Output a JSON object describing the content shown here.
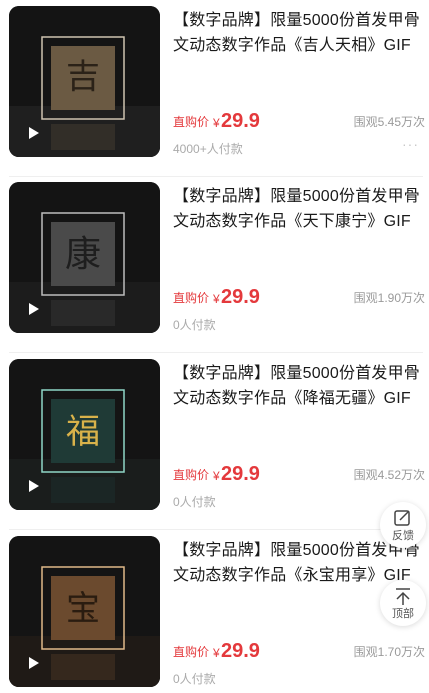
{
  "products": [
    {
      "title": "【数字品牌】限量5000份首发甲骨文动态数字作品《吉人天相》GIF",
      "price_label": "直购价",
      "currency": "¥",
      "price": "29.9",
      "views": "围观5.45万次",
      "paid": "4000+人付款",
      "more": "···",
      "glyph": "吉",
      "tone": "#6b5a43",
      "frame": "#cfc4b0"
    },
    {
      "title": "【数字品牌】限量5000份首发甲骨文动态数字作品《天下康宁》GIF",
      "price_label": "直购价",
      "currency": "¥",
      "price": "29.9",
      "views": "围观1.90万次",
      "paid": "0人付款",
      "more": "···",
      "glyph": "康",
      "tone": "#4a4a4a",
      "frame": "#bdbdbd"
    },
    {
      "title": "【数字品牌】限量5000份首发甲骨文动态数字作品《降福无疆》GIF",
      "price_label": "直购价",
      "currency": "¥",
      "price": "29.9",
      "views": "围观4.52万次",
      "paid": "0人付款",
      "more": "···",
      "glyph": "福",
      "tone": "#1f3a36",
      "frame": "#8fd6c6"
    },
    {
      "title": "【数字品牌】限量5000份首发甲骨文动态数字作品《永宝用享》GIF",
      "price_label": "直购价",
      "currency": "¥",
      "price": "29.9",
      "views": "围观1.70万次",
      "paid": "0人付款",
      "more": "···",
      "glyph": "宝",
      "tone": "#6b4a2e",
      "frame": "#e0b98a"
    }
  ],
  "float_feedback": {
    "label": "反馈",
    "icon": "edit-icon"
  },
  "float_top": {
    "label": "顶部",
    "icon": "arrow-up-icon"
  }
}
